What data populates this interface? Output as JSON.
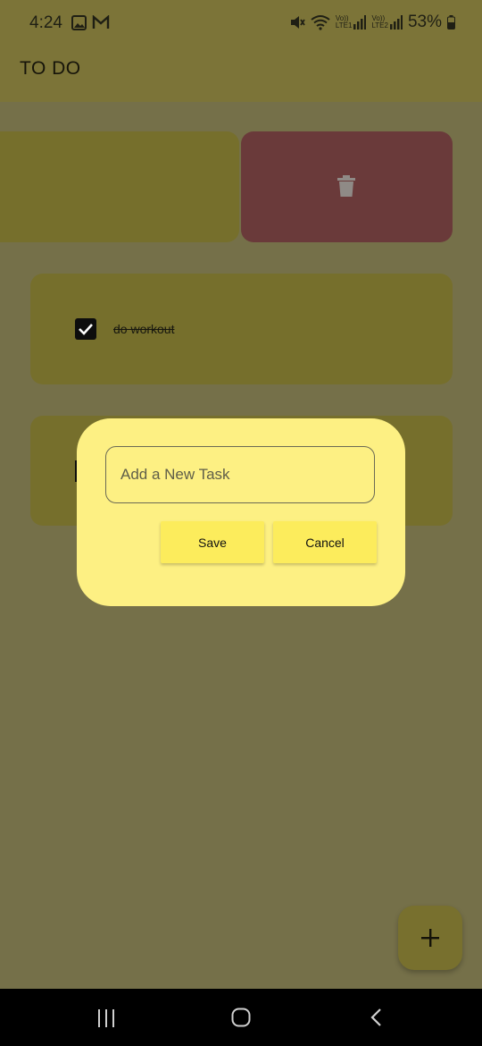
{
  "status_bar": {
    "time": "4:24",
    "battery": "53%",
    "left_icons": [
      "image-icon",
      "gmail-icon"
    ],
    "right_icons": [
      "mute-icon",
      "wifi-icon",
      "signal-lte1-icon",
      "signal-lte2-icon",
      "battery-icon"
    ],
    "lte1_label": "LTE1",
    "lte2_label": "LTE2",
    "volte_label": "Vo))"
  },
  "app_bar": {
    "title": "TO DO"
  },
  "tasks": [
    {
      "text": "",
      "swiped": true
    },
    {
      "text": "do workout",
      "completed": true
    },
    {
      "text": "",
      "completed": false
    }
  ],
  "dialog": {
    "input_placeholder": "Add a New Task",
    "input_value": "",
    "save_label": "Save",
    "cancel_label": "Cancel"
  },
  "fab": {
    "icon": "plus-icon"
  },
  "nav_bar": {
    "icons": [
      "recent-apps-icon",
      "home-icon",
      "back-icon"
    ]
  },
  "colors": {
    "dialog_bg": "#fdf083",
    "button_bg": "#fcec5c",
    "delete_bg": "#6a3a3a",
    "scrim_bg": "#757049"
  }
}
